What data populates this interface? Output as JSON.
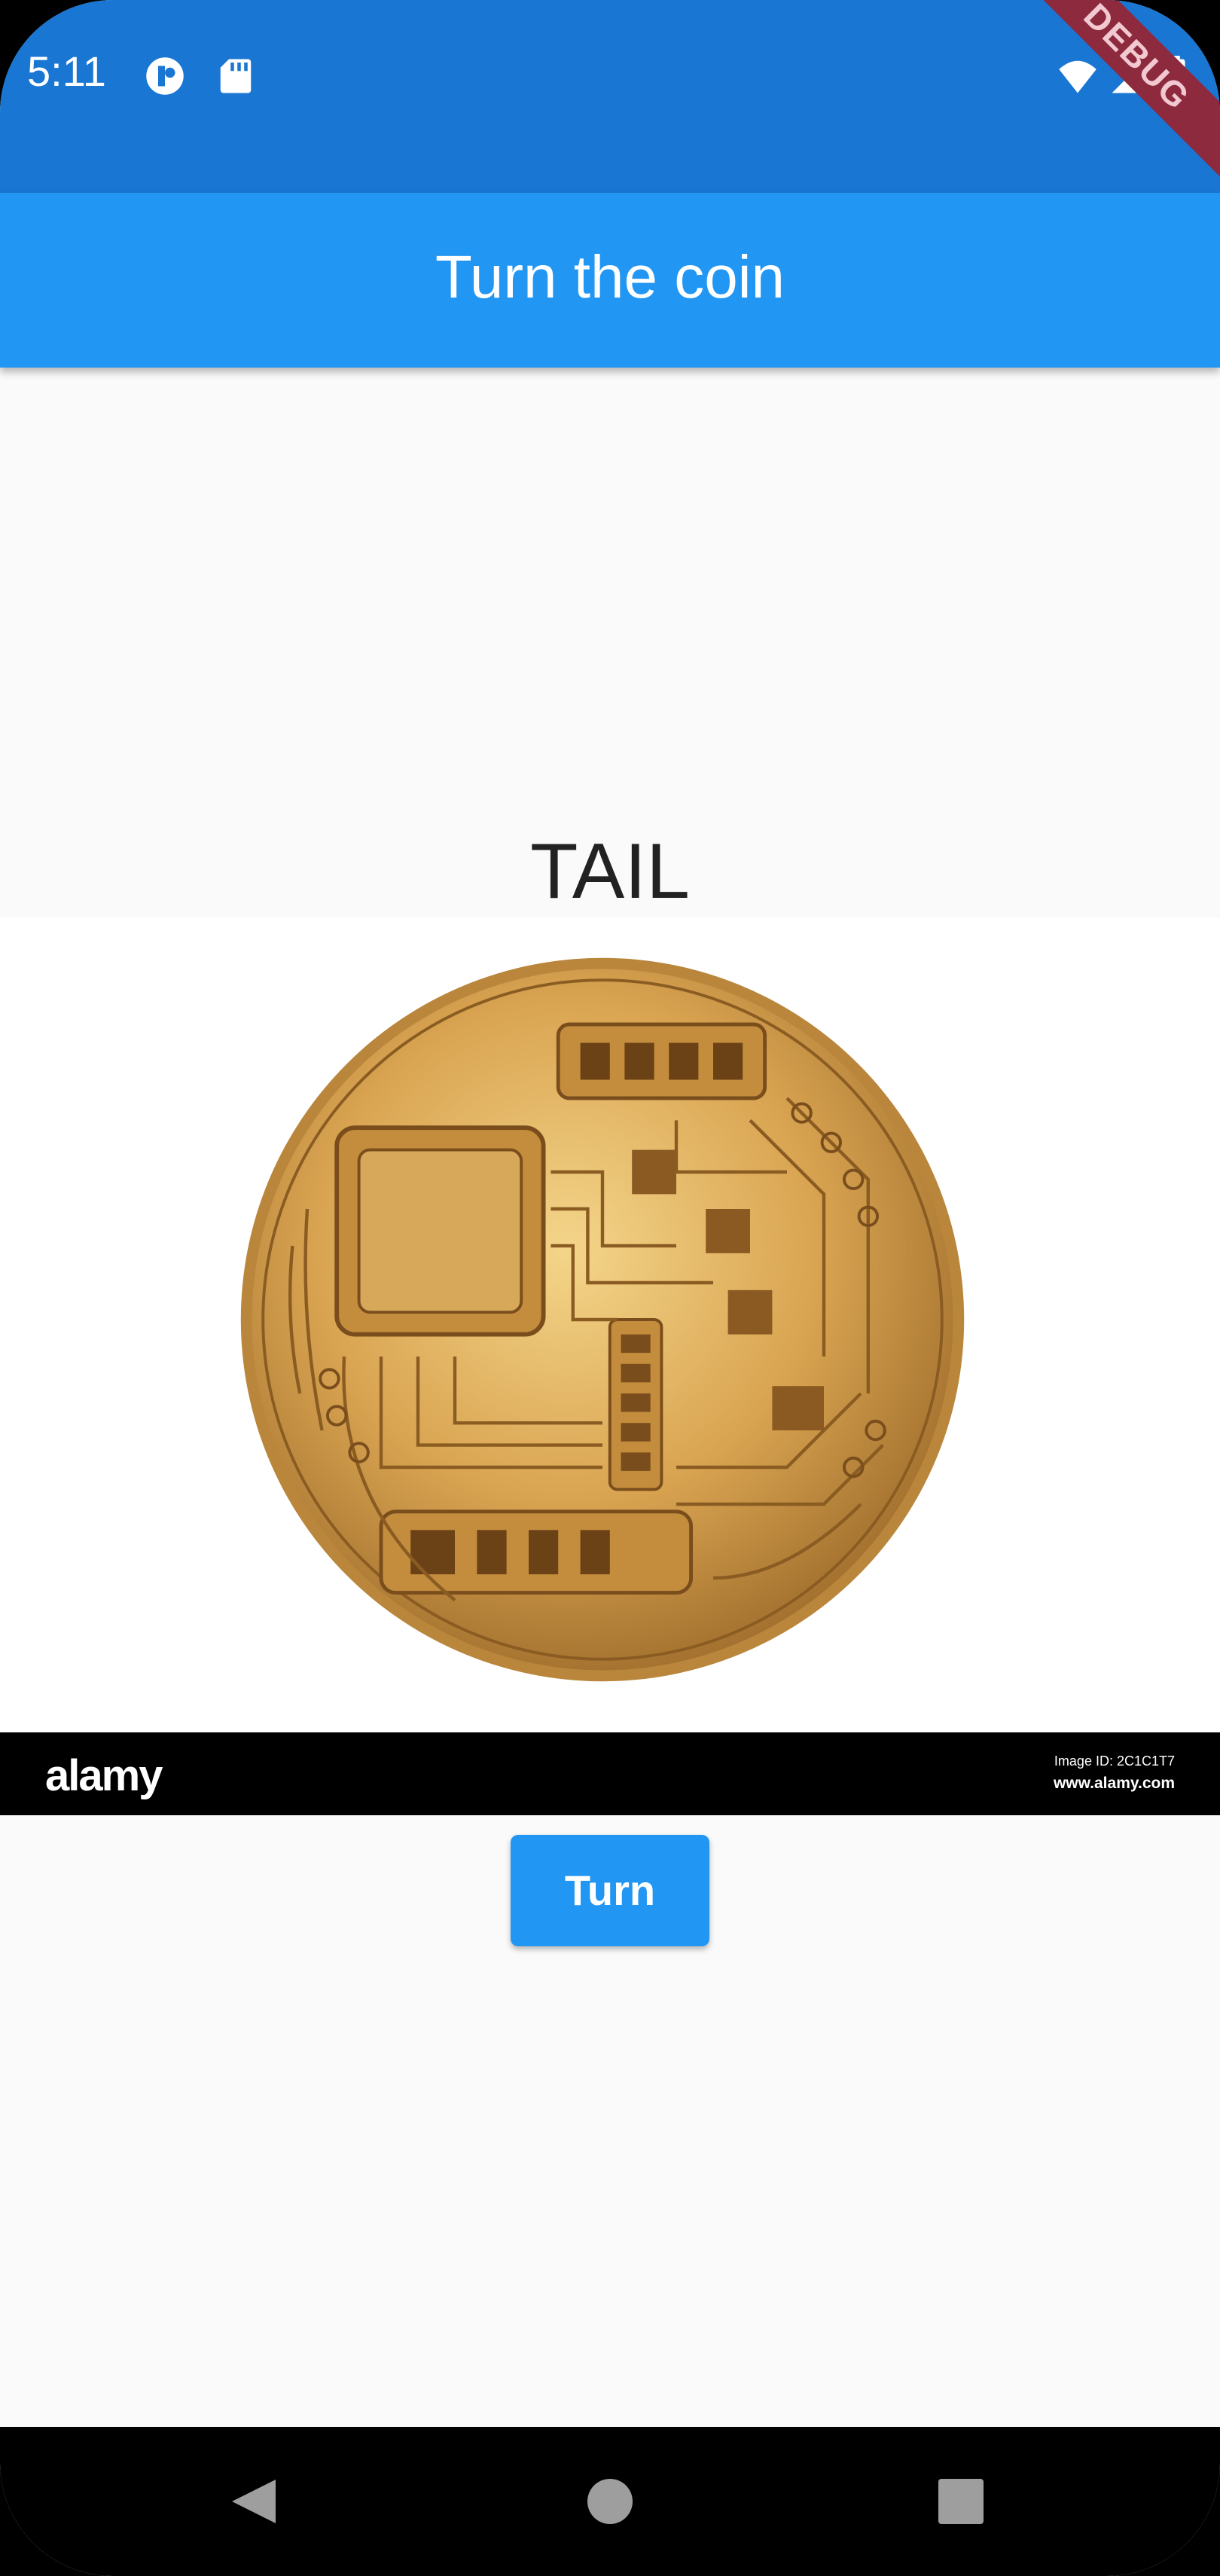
{
  "status_bar": {
    "time": "5:11",
    "icons": [
      "app-notification-icon",
      "sd-card-icon",
      "wifi-icon",
      "signal-icon",
      "battery-icon"
    ],
    "debug_banner": "DEBUG"
  },
  "app_bar": {
    "title": "Turn the coin"
  },
  "main": {
    "result": "TAIL",
    "coin_image": {
      "watermark_logo": "alamy",
      "image_id": "Image ID: 2C1C1T7",
      "url": "www.alamy.com"
    },
    "turn_button_label": "Turn"
  },
  "nav_bar": {
    "buttons": [
      "back-icon",
      "home-icon",
      "recents-icon"
    ]
  },
  "colors": {
    "status_bar": "#1976d2",
    "app_bar": "#2196f3",
    "button": "#2196f3",
    "background": "#fafafa"
  }
}
